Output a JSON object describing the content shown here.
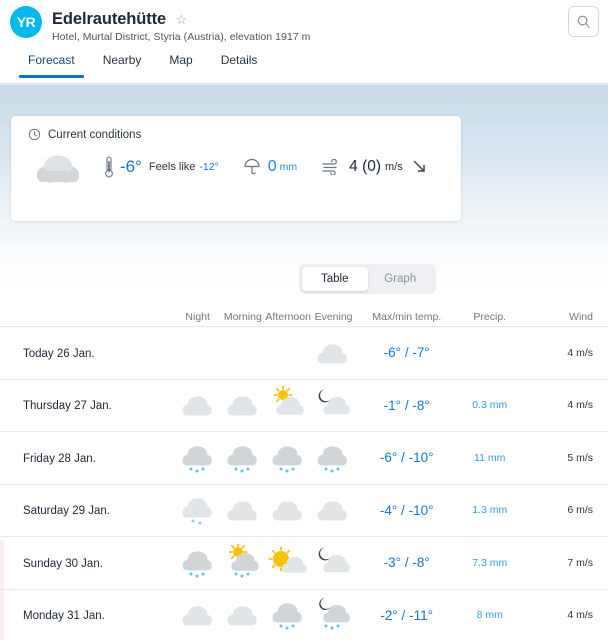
{
  "header": {
    "logo_text": "YR",
    "place_name": "Edelrautehütte",
    "favorite_icon": "star-outline-icon",
    "place_subtitle": "Hotel, Murtal District, Styria (Austria), elevation 1917 m",
    "search_icon": "search-icon"
  },
  "tabs": [
    {
      "label": "Forecast",
      "active": true
    },
    {
      "label": "Nearby",
      "active": false
    },
    {
      "label": "Map",
      "active": false
    },
    {
      "label": "Details",
      "active": false
    }
  ],
  "current_conditions": {
    "clock_icon": "clock-icon",
    "title": "Current conditions",
    "weather_icon": "cloudy-icon",
    "thermometer_icon": "thermometer-icon",
    "temperature": "-6°",
    "feels_like_label": "Feels like",
    "feels_like_value": "-12°",
    "umbrella_icon": "umbrella-icon",
    "precip_value": "0",
    "precip_unit": "mm",
    "wind_icon": "wind-lines-icon",
    "wind_value": "4 (0)",
    "wind_unit": "m/s",
    "wind_direction_icon": "arrow-south-east-icon"
  },
  "view_toggle": {
    "options": [
      {
        "label": "Table",
        "selected": true
      },
      {
        "label": "Graph",
        "selected": false
      }
    ]
  },
  "forecast_table": {
    "columns": {
      "day": "",
      "night": "Night",
      "morning": "Morning",
      "afternoon": "Afternoon",
      "evening": "Evening",
      "temp": "Max/min temp.",
      "precip": "Precip.",
      "wind": "Wind"
    },
    "rows": [
      {
        "day": "Today 26 Jan.",
        "icons": [
          "",
          "",
          "",
          "cloudy"
        ],
        "temp_max": "-6°",
        "temp_sep": "/",
        "temp_min": "-7°",
        "precip": "",
        "wind": "4 m/s"
      },
      {
        "day": "Thursday 27 Jan.",
        "icons": [
          "cloudy",
          "cloudy",
          "partly-sunny",
          "partly-moon"
        ],
        "temp_max": "-1°",
        "temp_sep": "/",
        "temp_min": "-8°",
        "precip": "0.3 mm",
        "wind": "4 m/s"
      },
      {
        "day": "Friday 28 Jan.",
        "icons": [
          "snow",
          "snow",
          "snow",
          "snow"
        ],
        "temp_max": "-6°",
        "temp_sep": "/",
        "temp_min": "-10°",
        "precip": "11 mm",
        "wind": "5 m/s"
      },
      {
        "day": "Saturday 29 Jan.",
        "icons": [
          "light-snow",
          "cloudy",
          "cloudy",
          "cloudy"
        ],
        "temp_max": "-4°",
        "temp_sep": "/",
        "temp_min": "-10°",
        "precip": "1.3 mm",
        "wind": "6 m/s"
      },
      {
        "day": "Sunday 30 Jan.",
        "icons": [
          "snow",
          "partly-sunny-snow",
          "sunny-cloud",
          "partly-moon"
        ],
        "temp_max": "-3°",
        "temp_sep": "/",
        "temp_min": "-8°",
        "precip": "7.3 mm",
        "wind": "7 m/s"
      },
      {
        "day": "Monday 31 Jan.",
        "icons": [
          "cloudy",
          "cloudy",
          "snow",
          "partly-moon-snow"
        ],
        "temp_max": "-2°",
        "temp_sep": "/",
        "temp_min": "-11°",
        "precip": "8 mm",
        "wind": "4 m/s"
      }
    ]
  },
  "colors": {
    "brand_cyan": "#00b9f1",
    "accent_blue": "#1176d3",
    "precip_blue": "#2f9de0",
    "tab_underline": "#0f70d2"
  }
}
